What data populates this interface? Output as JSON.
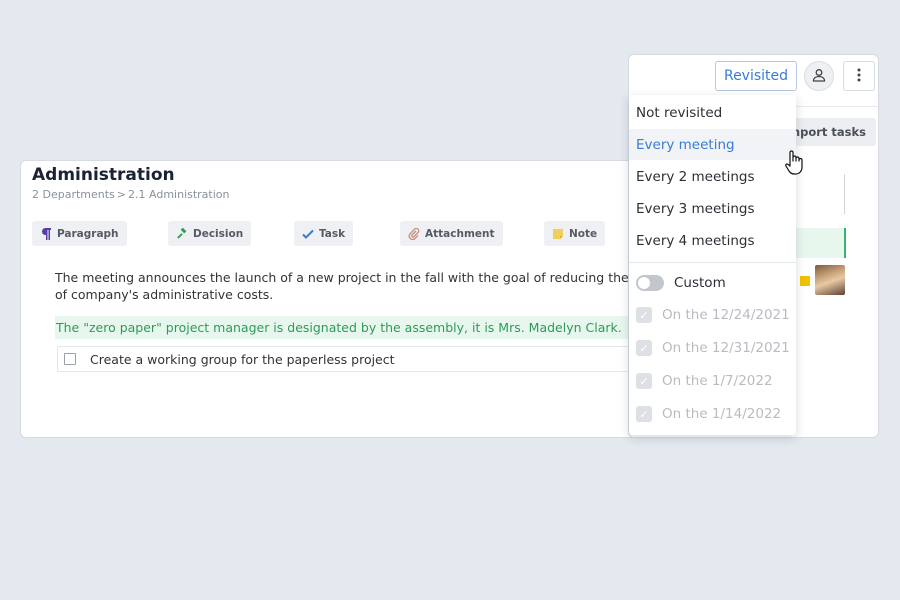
{
  "document": {
    "title": "Administration",
    "breadcrumb": [
      "2 Departments",
      ">",
      "2.1 Administration"
    ],
    "toolbar": [
      {
        "label": "Paragraph",
        "icon": "paragraph-icon",
        "color": "#5a3ea6"
      },
      {
        "label": "Decision",
        "icon": "gavel-icon",
        "color": "#2e9a58"
      },
      {
        "label": "Task",
        "icon": "checkmark-icon",
        "color": "#3a7bd5"
      },
      {
        "label": "Attachment",
        "icon": "paperclip-icon",
        "color": "#c98a7a"
      },
      {
        "label": "Note",
        "icon": "sticky-note-icon",
        "color": "#e8c24a"
      }
    ],
    "paragraph": "The meeting announces the launch of a new project in the fall with the goal of reducing the use of company's administrative costs.",
    "decision": "The \"zero paper\" project manager is designated by the assembly, it is Mrs. Madelyn Clark.",
    "task": "Create a working group for the paperless project"
  },
  "panel": {
    "revisited_label": "Revisited",
    "import_label": "Import tasks",
    "accent_color": "#3a7bd5"
  },
  "dropdown": {
    "options": [
      "Not revisited",
      "Every meeting",
      "Every 2 meetings",
      "Every 3 meetings",
      "Every 4 meetings"
    ],
    "selected": "Every meeting",
    "custom_label": "Custom",
    "custom_enabled": false,
    "dates": [
      "On the 12/24/2021",
      "On the 12/31/2021",
      "On the 1/7/2022",
      "On the 1/14/2022"
    ]
  }
}
